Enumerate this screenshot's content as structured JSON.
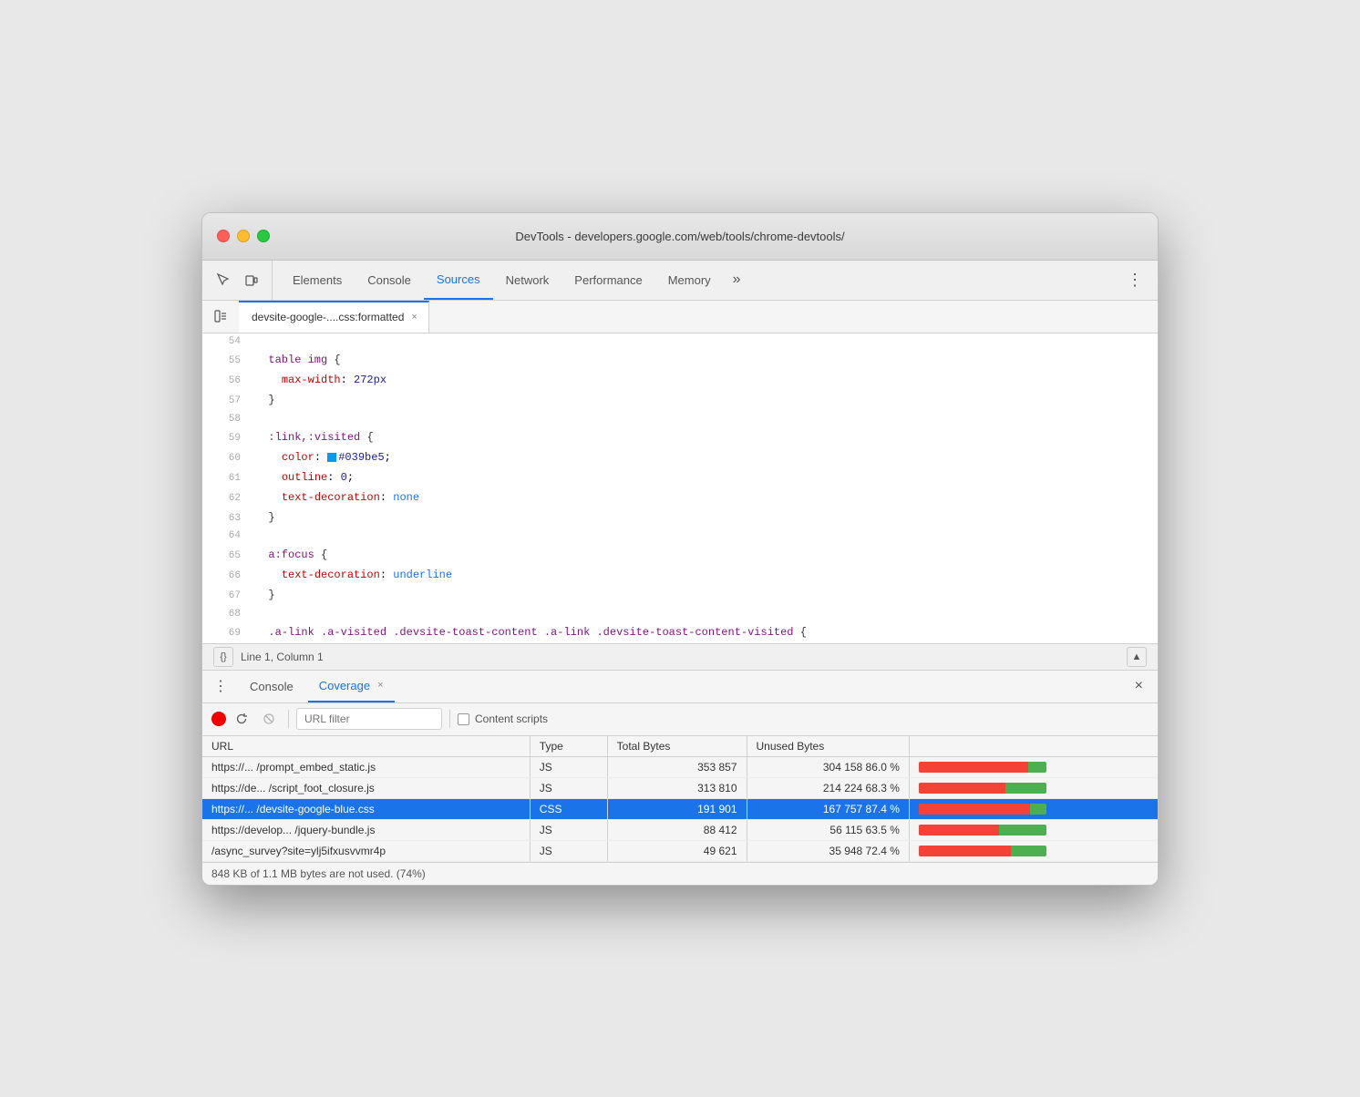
{
  "window": {
    "title": "DevTools - developers.google.com/web/tools/chrome-devtools/"
  },
  "tabs": {
    "items": [
      {
        "id": "elements",
        "label": "Elements",
        "active": false
      },
      {
        "id": "console",
        "label": "Console",
        "active": false
      },
      {
        "id": "sources",
        "label": "Sources",
        "active": true
      },
      {
        "id": "network",
        "label": "Network",
        "active": false
      },
      {
        "id": "performance",
        "label": "Performance",
        "active": false
      },
      {
        "id": "memory",
        "label": "Memory",
        "active": false
      }
    ],
    "more": "»",
    "menu_icon": "⋮"
  },
  "file_tab": {
    "label": "devsite-google-....css:formatted",
    "close": "×"
  },
  "code": {
    "lines": [
      {
        "num": 54,
        "content": "",
        "gutter": false
      },
      {
        "num": 55,
        "content": "  table img {",
        "gutter": true
      },
      {
        "num": 56,
        "content": "    max-width: 272px",
        "gutter": false
      },
      {
        "num": 57,
        "content": "  }",
        "gutter": false
      },
      {
        "num": 58,
        "content": "",
        "gutter": false
      },
      {
        "num": 59,
        "content": "  :link,:visited {",
        "gutter": false
      },
      {
        "num": 60,
        "content": "    color: #039be5;",
        "gutter": false
      },
      {
        "num": 61,
        "content": "    outline: 0;",
        "gutter": false
      },
      {
        "num": 62,
        "content": "    text-decoration: none",
        "gutter": false
      },
      {
        "num": 63,
        "content": "  }",
        "gutter": false
      },
      {
        "num": 64,
        "content": "",
        "gutter": false
      },
      {
        "num": 65,
        "content": "  a:focus {",
        "gutter": false
      },
      {
        "num": 66,
        "content": "    text-decoration: underline",
        "gutter": false
      },
      {
        "num": 67,
        "content": "  }",
        "gutter": false
      },
      {
        "num": 68,
        "content": "",
        "gutter": false
      },
      {
        "num": 69,
        "content": "  .a-link .a-visited .devsite-toast-content .a-link .devsite-toast-content-visited {",
        "gutter": false
      }
    ]
  },
  "status_bar": {
    "brace_label": "{}",
    "position": "Line 1, Column 1",
    "scroll_up": "▲"
  },
  "bottom_panel": {
    "tabs": [
      {
        "id": "console",
        "label": "Console",
        "active": false,
        "closeable": false
      },
      {
        "id": "coverage",
        "label": "Coverage",
        "active": true,
        "closeable": true
      }
    ],
    "close_panel": "×"
  },
  "toolbar": {
    "record_title": "record",
    "reload_title": "reload",
    "stop_title": "stop",
    "url_filter_placeholder": "URL filter",
    "content_scripts_label": "Content scripts"
  },
  "coverage_table": {
    "columns": [
      "URL",
      "Type",
      "Total Bytes",
      "Unused Bytes",
      ""
    ],
    "rows": [
      {
        "url": "https://... /prompt_embed_static.js",
        "type": "JS",
        "total_bytes": "353 857",
        "unused_bytes": "304 158",
        "unused_pct": "86.0 %",
        "bar_unused_pct": 86,
        "selected": false
      },
      {
        "url": "https://de... /script_foot_closure.js",
        "type": "JS",
        "total_bytes": "313 810",
        "unused_bytes": "214 224",
        "unused_pct": "68.3 %",
        "bar_unused_pct": 68,
        "selected": false
      },
      {
        "url": "https://... /devsite-google-blue.css",
        "type": "CSS",
        "total_bytes": "191 901",
        "unused_bytes": "167 757",
        "unused_pct": "87.4 %",
        "bar_unused_pct": 87,
        "selected": true
      },
      {
        "url": "https://develop... /jquery-bundle.js",
        "type": "JS",
        "total_bytes": "88 412",
        "unused_bytes": "56 115",
        "unused_pct": "63.5 %",
        "bar_unused_pct": 63,
        "selected": false
      },
      {
        "url": "/async_survey?site=ylj5ifxusvvmr4p",
        "type": "JS",
        "total_bytes": "49 621",
        "unused_bytes": "35 948",
        "unused_pct": "72.4 %",
        "bar_unused_pct": 72,
        "selected": false
      }
    ]
  },
  "footer": {
    "text": "848 KB of 1.1 MB bytes are not used. (74%)"
  }
}
